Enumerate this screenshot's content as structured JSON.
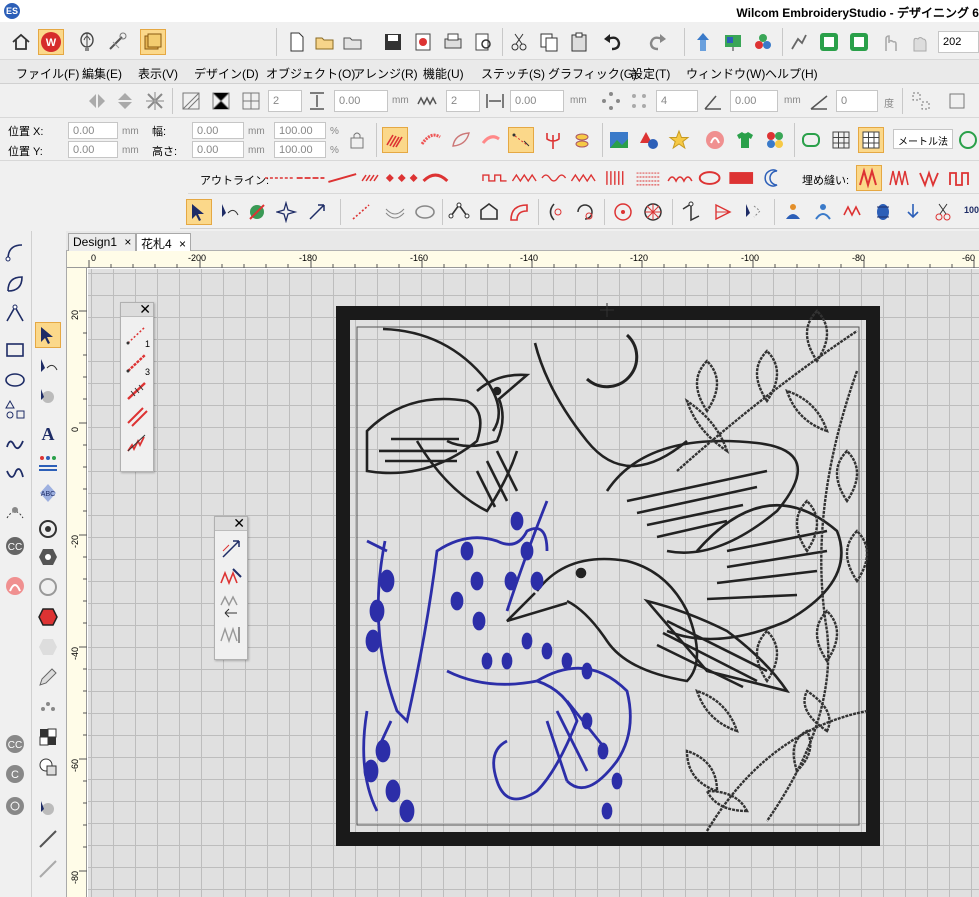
{
  "app": {
    "title": "Wilcom EmbroideryStudio - デザイニング 6",
    "logo_letter": "W"
  },
  "menu": [
    "ファイル(F)",
    "編集(E)",
    "表示(V)",
    "デザイン(D)",
    "オブジェクト(O)",
    "アレンジ(R)",
    "機能(U)",
    "ステッチ(S)",
    "グラフィック(G)",
    "設定(T)",
    "ウィンドウ(W)",
    "ヘルプ(H)"
  ],
  "toolbar1": {
    "zoom_value": "202"
  },
  "transform_bar": {
    "spin1": "2",
    "field1": "0.00",
    "unit1": "mm",
    "spin2": "2",
    "field2": "0.00",
    "unit2": "mm",
    "spin3": "4",
    "field3": "0.00",
    "unit3": "mm",
    "field4": "0",
    "unit4": "度"
  },
  "position_bar": {
    "pos_x_label": "位置 X:",
    "pos_x": "0.00",
    "pos_x_unit": "mm",
    "pos_y_label": "位置 Y:",
    "pos_y": "0.00",
    "pos_y_unit": "mm",
    "width_label": "幅:",
    "width": "0.00",
    "width_unit": "mm",
    "height_label": "高さ:",
    "height": "0.00",
    "height_unit": "mm",
    "scale_w": "100.00",
    "scale_h": "100.00",
    "pct": "%",
    "measure_select": "メートル法"
  },
  "stitch_bar": {
    "outline_label": "アウトライン:",
    "fill_label": "埋め縫い:"
  },
  "tabs": [
    {
      "label": "Design1",
      "close": "×"
    },
    {
      "label": "花札4",
      "close": "×"
    }
  ],
  "ruler": {
    "h_labels": [
      "0",
      "-200",
      "-180",
      "-160",
      "-140",
      "-120",
      "-100",
      "-80",
      "-60"
    ],
    "v_labels": [
      "20",
      "0",
      "-20",
      "-40",
      "-60",
      "-80"
    ]
  },
  "palette1": {
    "close": "✕",
    "items": [
      "1",
      "3"
    ]
  },
  "palette2": {
    "close": "✕"
  },
  "colors": {
    "frame": "#1a1a1a",
    "navy_thread": "#2c2ea8",
    "black_thread": "#222222",
    "accent_tab": "#fbd88a"
  }
}
